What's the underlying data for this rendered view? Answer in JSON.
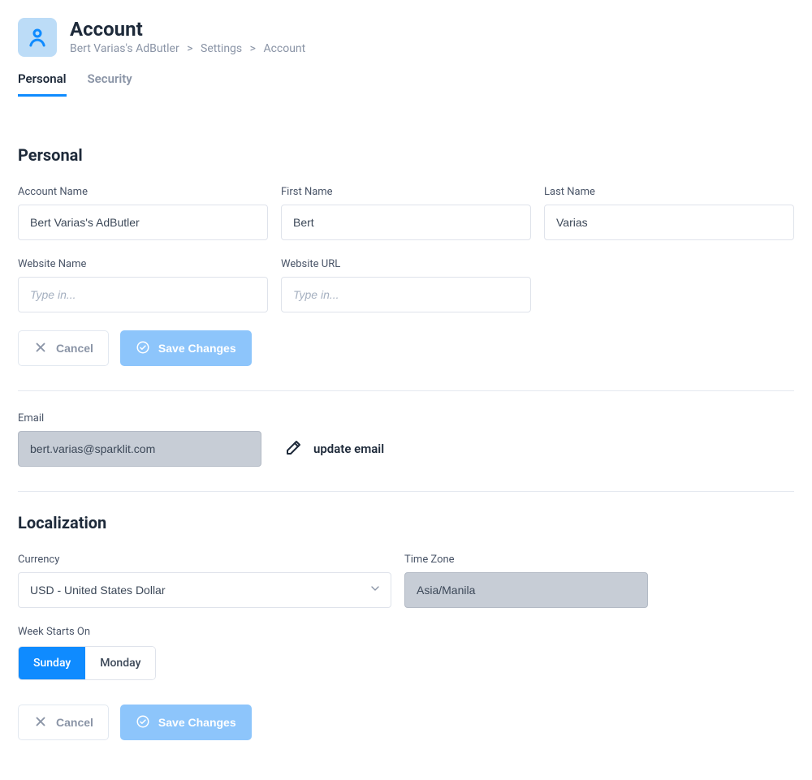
{
  "header": {
    "title": "Account",
    "breadcrumb": {
      "item1": "Bert Varias's AdButler",
      "item2": "Settings",
      "item3": "Account"
    }
  },
  "tabs": {
    "personal": "Personal",
    "security": "Security"
  },
  "personal_section": {
    "title": "Personal",
    "labels": {
      "account_name": "Account Name",
      "first_name": "First Name",
      "last_name": "Last Name",
      "website_name": "Website Name",
      "website_url": "Website URL"
    },
    "values": {
      "account_name": "Bert Varias's AdButler",
      "first_name": "Bert",
      "last_name": "Varias",
      "website_name": "",
      "website_url": ""
    },
    "placeholders": {
      "website_name": "Type in...",
      "website_url": "Type in..."
    }
  },
  "buttons": {
    "cancel": "Cancel",
    "save": "Save Changes"
  },
  "email_section": {
    "label": "Email",
    "value": "bert.varias@sparklit.com",
    "update_label": "update email"
  },
  "localization": {
    "title": "Localization",
    "labels": {
      "currency": "Currency",
      "timezone": "Time Zone",
      "week_starts": "Week Starts On"
    },
    "values": {
      "currency": "USD - United States Dollar",
      "timezone": "Asia/Manila"
    },
    "week_options": {
      "sunday": "Sunday",
      "monday": "Monday"
    }
  }
}
